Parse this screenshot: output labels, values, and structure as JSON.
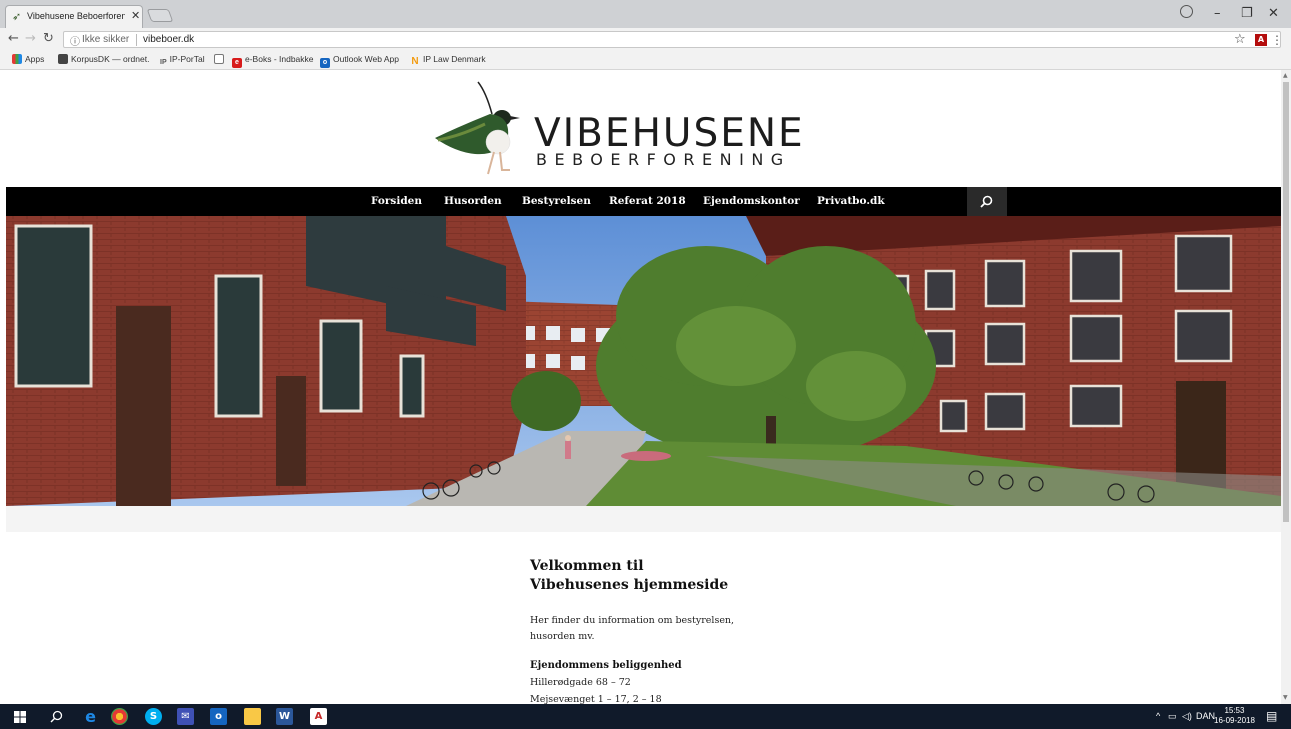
{
  "browser": {
    "tab_title": "Vibehusene Beboerforen",
    "not_secure": "Ikke sikker",
    "url": "vibeboer.dk",
    "bookmarks": [
      {
        "label": "Apps",
        "icon": "apps-grid-icon"
      },
      {
        "label": "KorpusDK — ordnet.",
        "icon": "korpus-icon"
      },
      {
        "label": "IP-PorTal",
        "icon": "ip-icon"
      },
      {
        "label": "",
        "icon": "blank-page-icon"
      },
      {
        "label": "e-Boks - Indbakke",
        "icon": "eboks-icon"
      },
      {
        "label": "Outlook Web App",
        "icon": "outlook-icon"
      },
      {
        "label": "IP Law Denmark",
        "icon": "n-icon"
      }
    ]
  },
  "site": {
    "logo_title": "VIBEHUSENE",
    "logo_subtitle": "BEBOERFORENING",
    "nav": [
      "Forsiden",
      "Husorden",
      "Bestyrelsen",
      "Referat 2018",
      "Ejendomskontor",
      "Privatbo.dk"
    ],
    "welcome_line1": "Velkommen til",
    "welcome_line2": "Vibehusenes hjemmeside",
    "intro_line1": "Her finder du information om bestyrelsen,",
    "intro_line2": "husorden mv.",
    "location_heading": "Ejendommens beliggenhed",
    "location_lines": [
      "Hillerødgade 68 – 72",
      "Mejsevænget 1 – 17, 2 – 18"
    ]
  },
  "taskbar": {
    "language": "DAN",
    "time": "15:53",
    "date": "16-09-2018"
  },
  "colors": {
    "navbar_bg": "#000000",
    "brick": "#8c3a2e",
    "bird_green": "#2f5a2c"
  }
}
